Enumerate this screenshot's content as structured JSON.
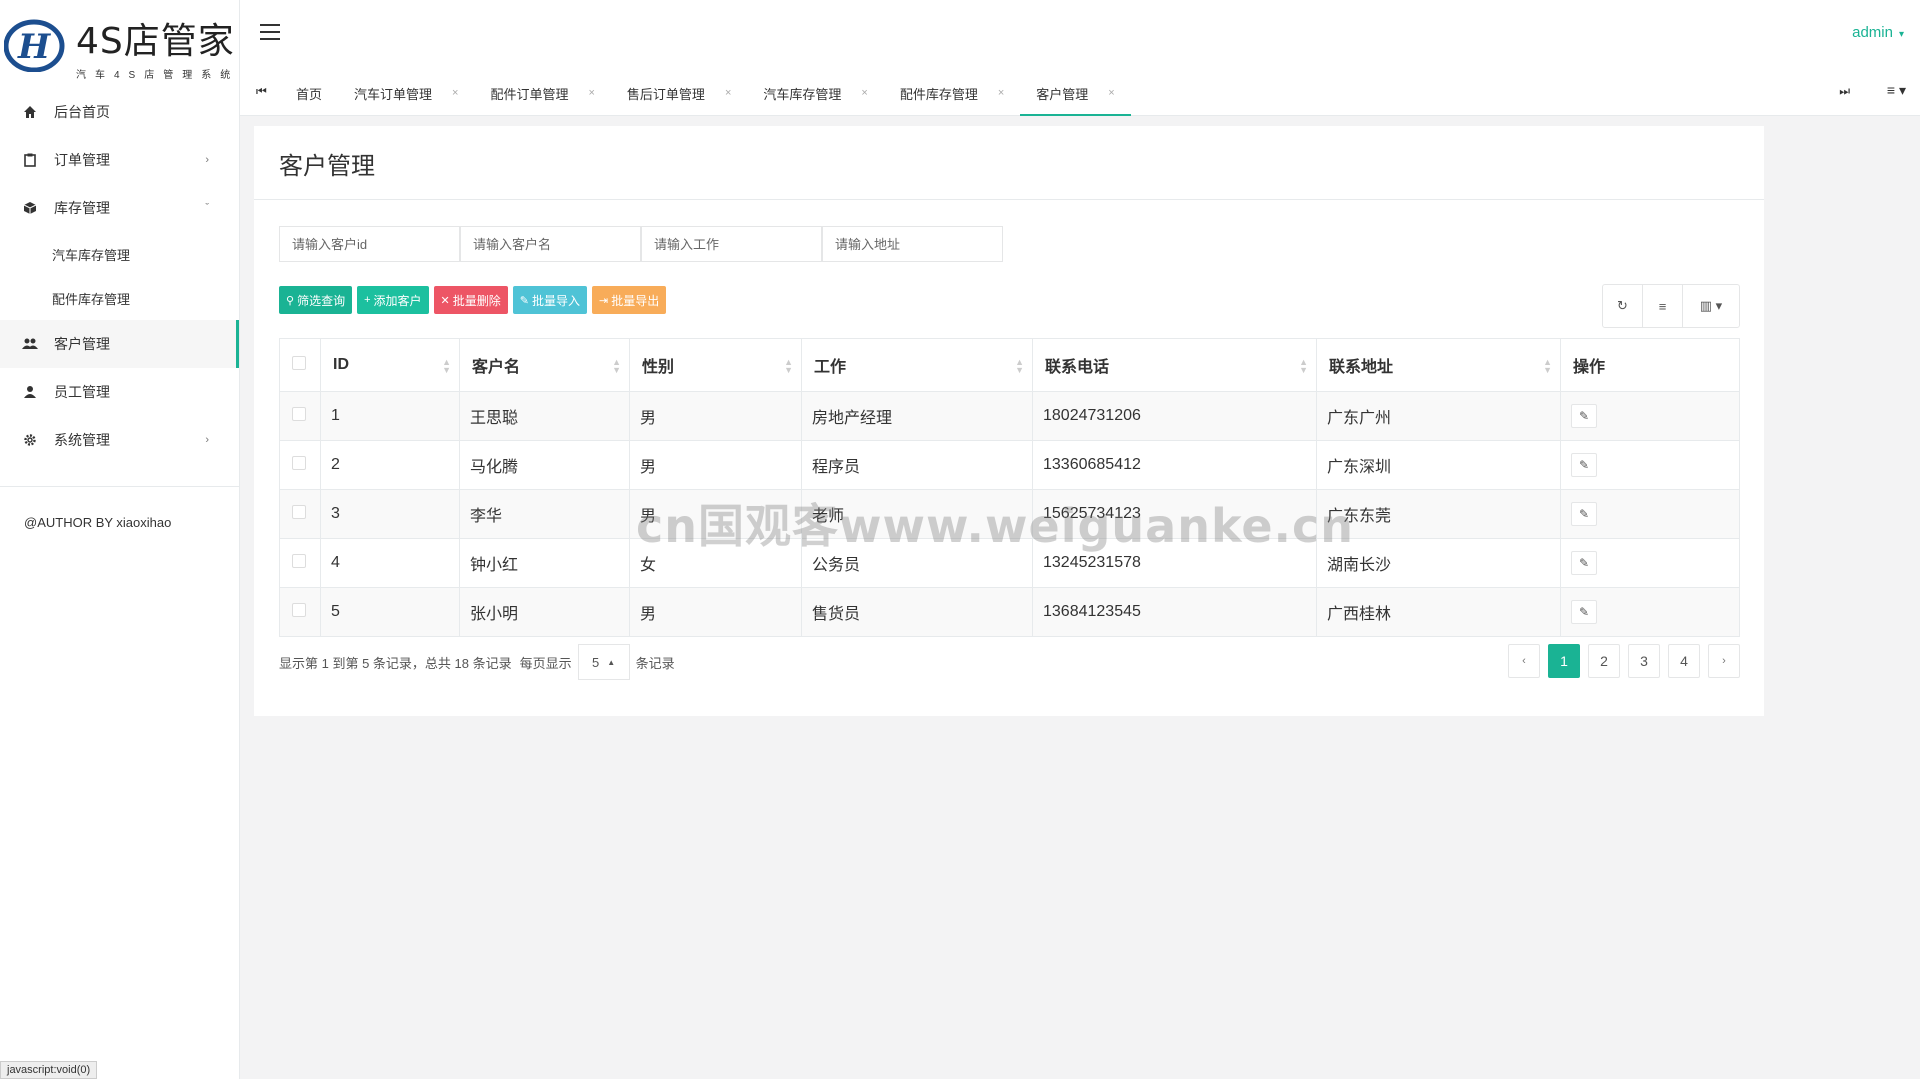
{
  "brand": {
    "name": "4S店管家",
    "subtitle": "汽车4S店管理系统"
  },
  "sidebar": {
    "items": [
      {
        "label": "后台首页",
        "icon": "home-icon"
      },
      {
        "label": "订单管理",
        "icon": "clipboard-icon"
      },
      {
        "label": "库存管理",
        "icon": "box-icon"
      },
      {
        "label": "汽车库存管理"
      },
      {
        "label": "配件库存管理"
      },
      {
        "label": "客户管理",
        "icon": "users-icon"
      },
      {
        "label": "员工管理",
        "icon": "user-icon"
      },
      {
        "label": "系统管理",
        "icon": "gear-icon"
      }
    ],
    "author": "@AUTHOR BY xiaoxihao"
  },
  "header": {
    "user": "admin"
  },
  "tabs": [
    {
      "label": "首页"
    },
    {
      "label": "汽车订单管理"
    },
    {
      "label": "配件订单管理"
    },
    {
      "label": "售后订单管理"
    },
    {
      "label": "汽车库存管理"
    },
    {
      "label": "配件库存管理"
    },
    {
      "label": "客户管理"
    }
  ],
  "page": {
    "title": "客户管理",
    "filters": {
      "id_placeholder": "请输入客户id",
      "name_placeholder": "请输入客户名",
      "job_placeholder": "请输入工作",
      "address_placeholder": "请输入地址"
    },
    "actions": {
      "search": "筛选查询",
      "add": "添加客户",
      "delete": "批量删除",
      "import": "批量导入",
      "export": "批量导出"
    },
    "table": {
      "columns": [
        "ID",
        "客户名",
        "性别",
        "工作",
        "联系电话",
        "联系地址",
        "操作"
      ],
      "rows": [
        {
          "id": "1",
          "name": "王思聪",
          "gender": "男",
          "job": "房地产经理",
          "phone": "18024731206",
          "address": "广东广州"
        },
        {
          "id": "2",
          "name": "马化腾",
          "gender": "男",
          "job": "程序员",
          "phone": "13360685412",
          "address": "广东深圳"
        },
        {
          "id": "3",
          "name": "李华",
          "gender": "男",
          "job": "老师",
          "phone": "15625734123",
          "address": "广东东莞"
        },
        {
          "id": "4",
          "name": "钟小红",
          "gender": "女",
          "job": "公务员",
          "phone": "13245231578",
          "address": "湖南长沙"
        },
        {
          "id": "5",
          "name": "张小明",
          "gender": "男",
          "job": "售货员",
          "phone": "13684123545",
          "address": "广西桂林"
        }
      ]
    },
    "pager": {
      "info": "显示第 1 到第 5 条记录，总共 18 条记录",
      "per_page_label": "每页显示",
      "per_page": "5",
      "records_label": "条记录",
      "pages": [
        "1",
        "2",
        "3",
        "4"
      ],
      "prev": "‹",
      "next": "›"
    }
  },
  "watermark": "cn国观客www.weiguanke.cn",
  "statusbar": "javascript:void(0)",
  "colors": {
    "accent": "#1ab394",
    "danger": "#ed5565",
    "info": "#4fc3d6",
    "warning": "#f8ac59"
  }
}
